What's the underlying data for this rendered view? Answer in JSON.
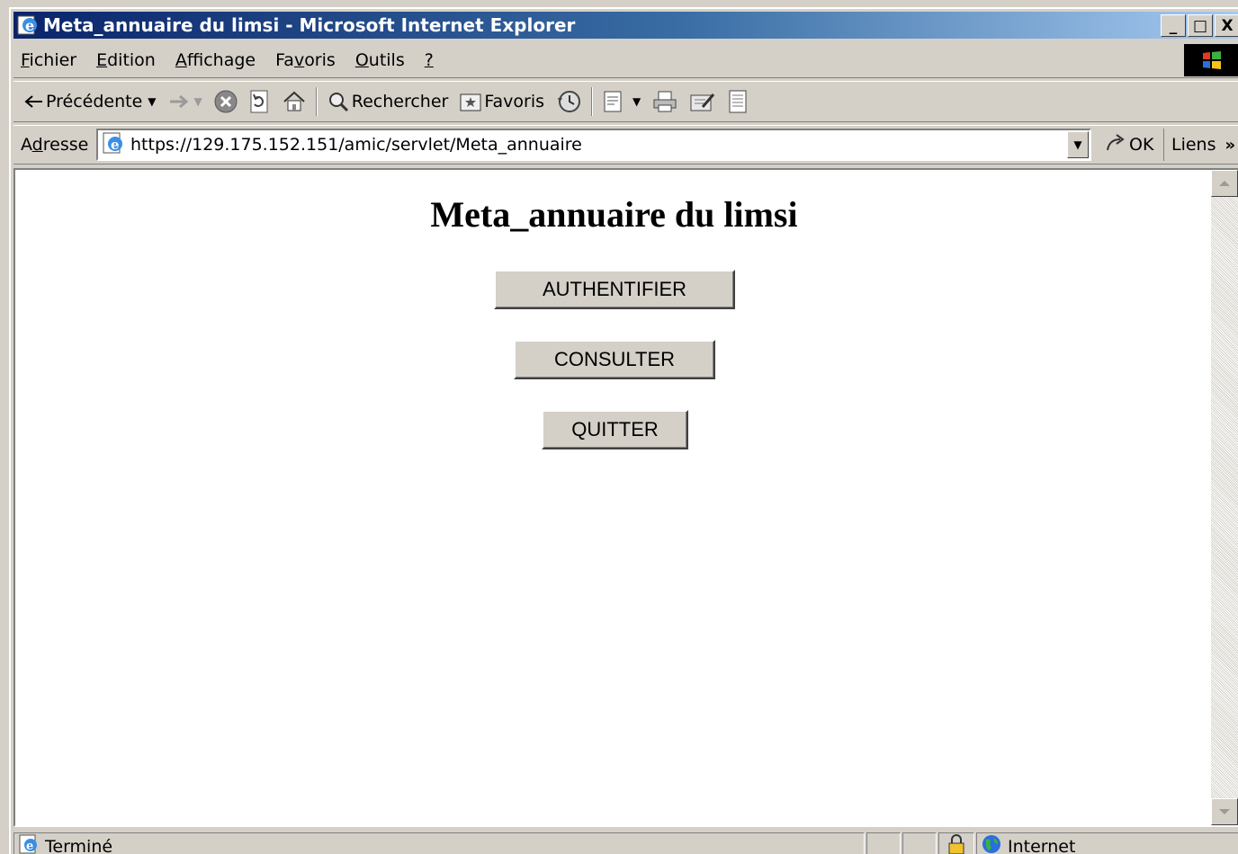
{
  "window": {
    "title": "Meta_annuaire du limsi - Microsoft Internet Explorer",
    "controls": {
      "minimize": "_",
      "maximize": "□",
      "close": "X"
    }
  },
  "menubar": {
    "items": [
      {
        "label": "Fichier",
        "accel": "F",
        "rest": "ichier"
      },
      {
        "label": "Edition",
        "accel": "E",
        "rest": "dition"
      },
      {
        "label": "Affichage",
        "accel": "A",
        "rest": "ffichage"
      },
      {
        "label": "Favoris",
        "pre": "Fa",
        "accel": "v",
        "rest": "oris"
      },
      {
        "label": "Outils",
        "accel": "O",
        "rest": "utils"
      },
      {
        "label": "?",
        "accel": "?",
        "rest": ""
      }
    ]
  },
  "toolbar": {
    "back_label": "Précédente",
    "search_label": "Rechercher",
    "favorites_label": "Favoris"
  },
  "addressbar": {
    "label_pre": "A",
    "label_accel": "d",
    "label_rest": "resse",
    "url": "https://129.175.152.151/amic/servlet/Meta_annuaire",
    "go_label": "OK",
    "links_label": "Liens",
    "links_more": "»"
  },
  "page": {
    "heading": "Meta_annuaire du limsi",
    "buttons": {
      "authenticate": "AUTHENTIFIER",
      "consult": "CONSULTER",
      "quit": "QUITTER"
    }
  },
  "statusbar": {
    "status": "Terminé",
    "zone": "Internet"
  },
  "colors": {
    "titlebar_start": "#0a246a",
    "titlebar_end": "#a6caf0",
    "chrome": "#d4d0c8"
  },
  "icons": [
    "ie-icon",
    "back-arrow-icon",
    "forward-arrow-icon",
    "stop-icon",
    "refresh-icon",
    "home-icon",
    "search-icon",
    "favorites-icon",
    "history-icon",
    "mail-icon",
    "print-icon",
    "edit-icon",
    "discuss-icon",
    "go-arrow-icon",
    "windows-logo-icon",
    "lock-icon",
    "globe-icon"
  ]
}
